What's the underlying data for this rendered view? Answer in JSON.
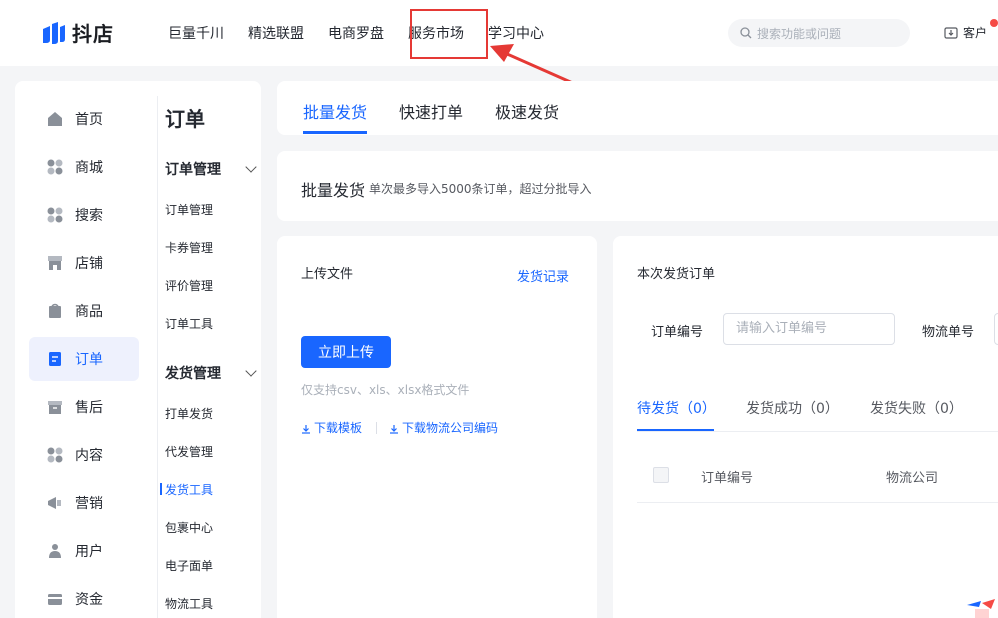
{
  "brand": {
    "name": "抖店"
  },
  "topnav": {
    "items": [
      "巨量千川",
      "精选联盟",
      "电商罗盘",
      "服务市场",
      "学习中心"
    ],
    "search_placeholder": "搜索功能或问题",
    "service_label": "客户"
  },
  "sidebar": {
    "items": [
      {
        "label": "首页",
        "icon": "home-icon"
      },
      {
        "label": "商城",
        "icon": "mall-icon"
      },
      {
        "label": "搜索",
        "icon": "search-cat-icon"
      },
      {
        "label": "店铺",
        "icon": "store-icon"
      },
      {
        "label": "商品",
        "icon": "goods-icon"
      },
      {
        "label": "订单",
        "icon": "order-icon",
        "active": true
      },
      {
        "label": "售后",
        "icon": "aftersale-icon"
      },
      {
        "label": "内容",
        "icon": "content-icon"
      },
      {
        "label": "营销",
        "icon": "marketing-icon"
      },
      {
        "label": "用户",
        "icon": "user-icon"
      },
      {
        "label": "资金",
        "icon": "funds-icon"
      }
    ]
  },
  "submenu": {
    "title": "订单",
    "group1": "订单管理",
    "group1_items": [
      "订单管理",
      "卡券管理",
      "评价管理",
      "订单工具"
    ],
    "group2": "发货管理",
    "group2_items": [
      "打单发货",
      "代发管理",
      "发货工具",
      "包裹中心",
      "电子面单",
      "物流工具"
    ]
  },
  "tabs": [
    "批量发货",
    "快速打单",
    "极速发货"
  ],
  "info": {
    "title": "批量发货",
    "desc": "单次最多导入5000条订单，超过分批导入"
  },
  "upload": {
    "title": "上传文件",
    "record_link": "发货记录",
    "button": "立即上传",
    "hint": "仅支持csv、xls、xlsx格式文件",
    "link1": "下载模板",
    "link2": "下载物流公司编码"
  },
  "orders": {
    "title": "本次发货订单",
    "order_label": "订单编号",
    "order_placeholder": "请输入订单编号",
    "logistics_label": "物流单号",
    "tabs": [
      "待发货（0）",
      "发货成功（0）",
      "发货失败（0）"
    ],
    "col1": "订单编号",
    "col2": "物流公司"
  },
  "colors": {
    "accent": "#1966ff",
    "highlight": "#e53935"
  }
}
